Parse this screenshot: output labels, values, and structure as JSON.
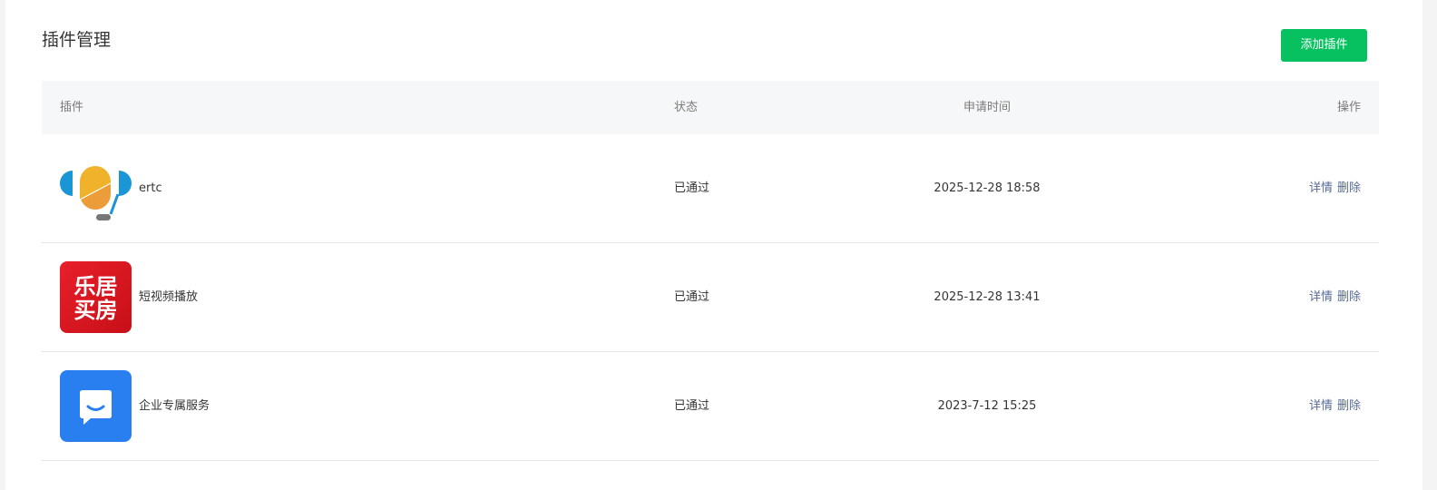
{
  "header": {
    "title": "插件管理",
    "add_button": "添加插件"
  },
  "table": {
    "columns": {
      "plugin": "插件",
      "status": "状态",
      "time": "申请时间",
      "action": "操作"
    },
    "rows": [
      {
        "name": "ertc",
        "icon": "ertc-logo-icon",
        "status": "已通过",
        "time": "2025-12-28 18:58",
        "detail": "详情",
        "delete": "删除"
      },
      {
        "name": "短视频播放",
        "icon": "short-video-logo-icon",
        "logo_text": [
          "乐居",
          "买房"
        ],
        "status": "已通过",
        "time": "2025-12-28 13:41",
        "detail": "详情",
        "delete": "删除"
      },
      {
        "name": "企业专属服务",
        "icon": "chat-bubble-icon",
        "status": "已通过",
        "time": "2023-7-12 15:25",
        "detail": "详情",
        "delete": "删除"
      }
    ]
  },
  "colors": {
    "accent_green": "#07c160",
    "link_blue": "#576b95",
    "chat_icon_bg": "#2a7ff0",
    "video_icon_bg": "#d8121c"
  }
}
